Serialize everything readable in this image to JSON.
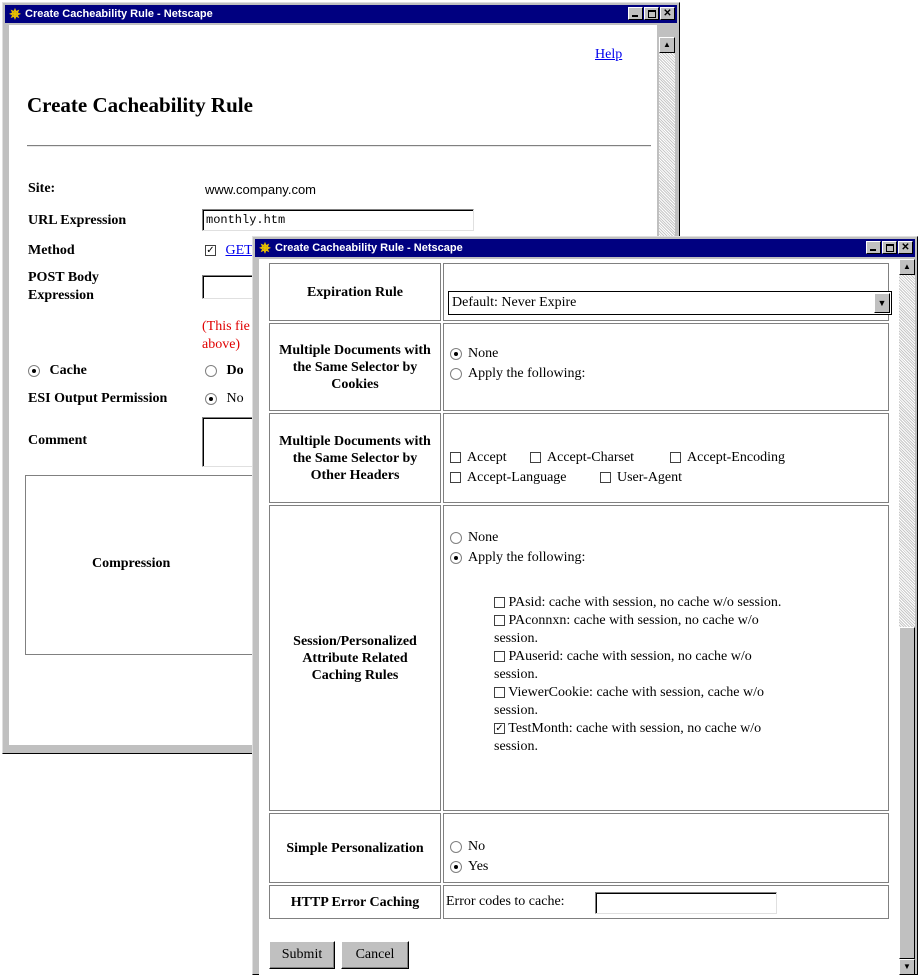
{
  "window1": {
    "title": "Create Cacheability Rule - Netscape",
    "help_link": "Help",
    "heading": "Create Cacheability Rule",
    "site_label": "Site:",
    "site_value": "www.company.com",
    "url_label": "URL Expression",
    "url_value": "monthly.htm",
    "method_label": "Method",
    "method_get": "GET",
    "post_label": "POST Body Expression",
    "note_line1": "(This fie",
    "note_line2": "above)",
    "cache_option": "Cache",
    "dont_option": "Do",
    "esi_label": "ESI Output Permission",
    "esi_no": "No",
    "comment_label": "Comment",
    "compression_label": "Compression"
  },
  "window2": {
    "title": "Create Cacheability Rule - Netscape",
    "expiration_label": "Expiration Rule",
    "expiration_value": "Default: Never Expire",
    "cookies_label": "Multiple Documents with the Same Selector by Cookies",
    "cookies_none": "None",
    "cookies_apply": "Apply the following:",
    "headers_label": "Multiple Documents with the Same Selector by Other Headers",
    "headers_options": [
      "Accept",
      "Accept-Charset",
      "Accept-Encoding",
      "Accept-Language",
      "User-Agent"
    ],
    "session_label": "Session/Personalized Attribute Related Caching Rules",
    "session_none": "None",
    "session_apply": "Apply the following:",
    "session_rules": [
      {
        "line1": "PAsid: cache with session, no cache w/o session.",
        "line2": "",
        "checked": false
      },
      {
        "line1": "PAconnxn: cache with session, no cache w/o",
        "line2": "session.",
        "checked": false
      },
      {
        "line1": "PAuserid: cache with session, no cache w/o",
        "line2": "session.",
        "checked": false
      },
      {
        "line1": "ViewerCookie: cache with session, cache w/o",
        "line2": "session.",
        "checked": false
      },
      {
        "line1": "TestMonth: cache with session, no cache w/o",
        "line2": "session.",
        "checked": true
      }
    ],
    "simple_label": "Simple Personalization",
    "simple_no": "No",
    "simple_yes": "Yes",
    "http_label": "HTTP Error Caching",
    "error_codes_label": "Error codes to cache:",
    "error_codes_value": "",
    "submit_label": "Submit",
    "cancel_label": "Cancel"
  }
}
